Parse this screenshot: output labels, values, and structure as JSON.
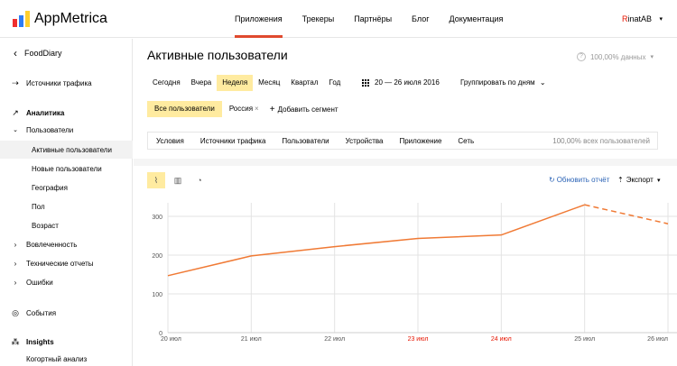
{
  "brand": {
    "name": "AppMetrica"
  },
  "nav": [
    {
      "label": "Приложения",
      "active": true
    },
    {
      "label": "Трекеры",
      "active": false
    },
    {
      "label": "Партнёры",
      "active": false
    },
    {
      "label": "Блог",
      "active": false
    },
    {
      "label": "Документация",
      "active": false
    }
  ],
  "user": {
    "first_letter": "R",
    "rest": "inatAB"
  },
  "sidebar": {
    "app_name": "FoodDiary",
    "items": [
      {
        "label": "Источники трафика"
      },
      {
        "label": "Аналитика"
      },
      {
        "label": "Пользователи"
      },
      {
        "label": "Активные пользователи"
      },
      {
        "label": "Новые пользователи"
      },
      {
        "label": "География"
      },
      {
        "label": "Пол"
      },
      {
        "label": "Возраст"
      },
      {
        "label": "Вовлеченность"
      },
      {
        "label": "Технические отчеты"
      },
      {
        "label": "Ошибки"
      },
      {
        "label": "События"
      },
      {
        "label": "Insights"
      },
      {
        "label": "Когортный анализ"
      }
    ]
  },
  "main": {
    "title": "Активные пользователи",
    "data_share": "100,00% данных",
    "periods": [
      "Сегодня",
      "Вчера",
      "Неделя",
      "Месяц",
      "Квартал",
      "Год"
    ],
    "date_range": "20 — 26 июля 2016",
    "grouping": "Группировать по дням",
    "segments": {
      "all": "Все пользователи",
      "country": "Россия",
      "add": "Добавить сегмент"
    },
    "dimensions": [
      "Условия",
      "Источники трафика",
      "Пользователи",
      "Устройства",
      "Приложение",
      "Сеть"
    ],
    "dimensions_share": "100,00% всех пользователей",
    "refresh": "Обновить отчёт",
    "export": "Экспорт"
  },
  "colors": {
    "accent": "#e04a2e",
    "line": "#f07a35",
    "highlight": "#ffeba0",
    "weekend": "#e61400",
    "link": "#2b63b6"
  },
  "chart_data": {
    "type": "line",
    "x": [
      "20 июл",
      "21 июл",
      "22 июл",
      "23 июл",
      "24 июл",
      "25 июл",
      "26 июл"
    ],
    "weekend": [
      false,
      false,
      false,
      true,
      true,
      false,
      false
    ],
    "series": [
      {
        "values": [
          147,
          198,
          222,
          243,
          252,
          330,
          281
        ]
      }
    ],
    "y_ticks": [
      0,
      100,
      200,
      300
    ],
    "ylim": [
      0,
      335
    ],
    "dashed_last_segment": true,
    "grid": true
  }
}
